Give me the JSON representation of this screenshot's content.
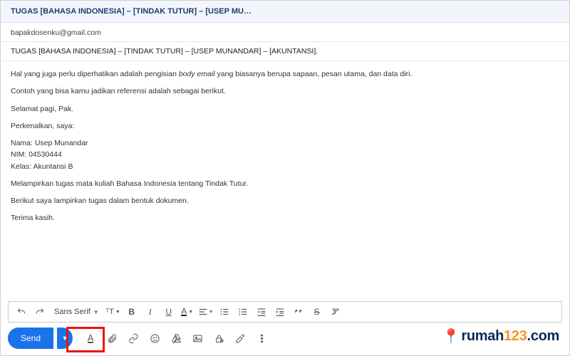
{
  "header": {
    "title": "TUGAS [BAHASA INDONESIA] – [TINDAK TUTUR] – [USEP MU…"
  },
  "to": {
    "address": "bapakdosenku@gmail.com"
  },
  "subject": {
    "text": "TUGAS [BAHASA INDONESIA] – [TINDAK TUTUR] – [USEP MUNANDAR]  – [AKUNTANSI]."
  },
  "body": {
    "p1a": "Hal yang juga perlu diperhatikan adalah pengisian ",
    "p1i": "body email",
    "p1b": " yang biasanya berupa sapaan, pesan utama, dan data diri.",
    "p2": "Contoh yang bisa kamu jadikan referensi adalah sebagai berikut.",
    "p3": "Selamat pagi, Pak.",
    "p4": "Perkenalkan, saya:",
    "p5": "Nama: Usep Munandar",
    "p6": "NIM: 04530444",
    "p7": "Kelas: Akuntansi B",
    "p8": "Melampirkan tugas mata kuliah Bahasa Indonesia tentang Tindak Tutur.",
    "p9": "Berikut saya lampirkan tugas dalam bentuk dokumen.",
    "p10": "Terima kasih."
  },
  "toolbar": {
    "font": "Sans Serif",
    "bold": "B",
    "italic": "I",
    "underline": "U"
  },
  "actions": {
    "send": "Send"
  },
  "watermark": {
    "brand": "rumah",
    "num": "123",
    "suffix": ".com"
  }
}
